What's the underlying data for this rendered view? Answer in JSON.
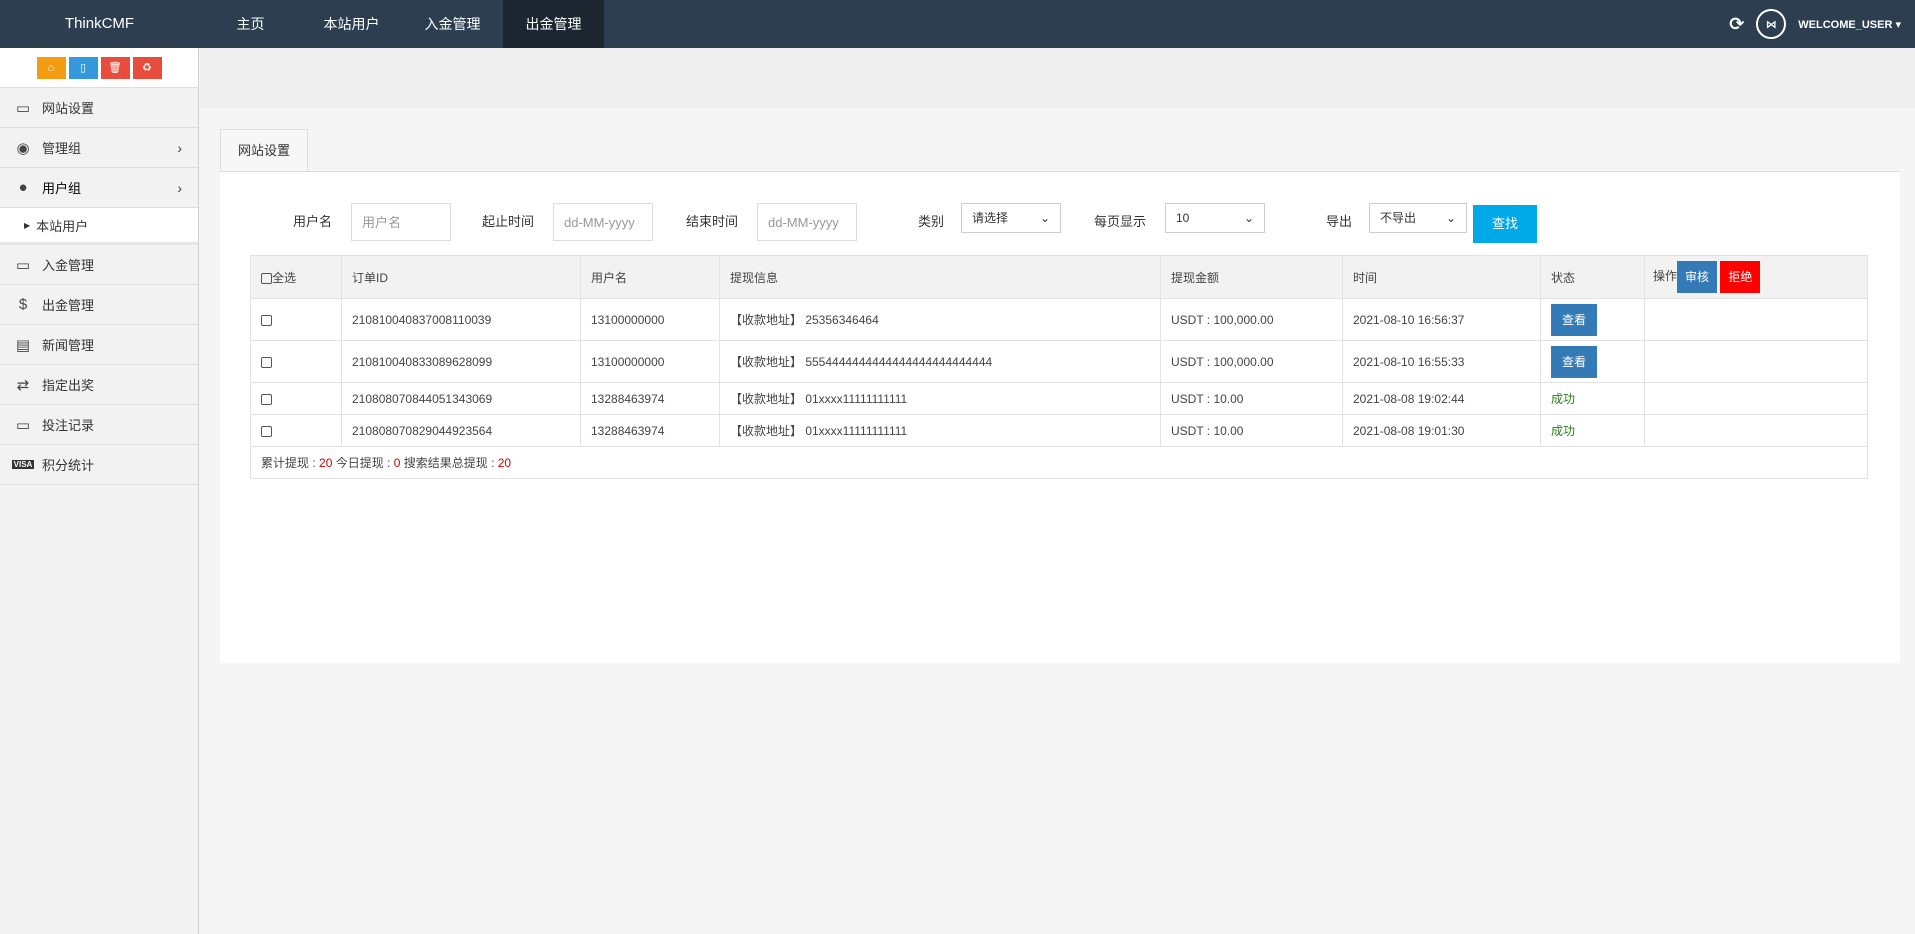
{
  "brand": "ThinkCMF",
  "nav": [
    "主页",
    "本站用户",
    "入金管理",
    "出金管理"
  ],
  "user": "WELCOME_USER",
  "sidebar": {
    "items": [
      "网站设置",
      "管理组",
      "用户组",
      "本站用户",
      "入金管理",
      "出金管理",
      "新闻管理",
      "指定出奖",
      "投注记录",
      "积分统计"
    ]
  },
  "tab": "网站设置",
  "filters": {
    "username_label": "用户名",
    "username_placeholder": "用户名",
    "start_label": "起止时间",
    "start_placeholder": "dd-MM-yyyy",
    "end_label": "结束时间",
    "end_placeholder": "dd-MM-yyyy",
    "type_label": "类别",
    "type_value": "请选择",
    "perpage_label": "每页显示",
    "perpage_value": "10",
    "export_label": "导出",
    "export_value": "不导出",
    "search": "查找"
  },
  "table": {
    "headers": [
      "全选",
      "订单ID",
      "用户名",
      "提现信息",
      "提现金额",
      "时间",
      "状态",
      "操作"
    ],
    "approve": "审核",
    "reject": "拒绝",
    "rows": [
      {
        "id": "210810040837008110039",
        "user": "13100000000",
        "info": "【收款地址】 25356346464",
        "amount": "USDT : 100,000.00",
        "time": "2021-08-10 16:56:37",
        "status": "查看"
      },
      {
        "id": "210810040833089628099",
        "user": "13100000000",
        "info": "【收款地址】 5554444444444444444444444444",
        "amount": "USDT : 100,000.00",
        "time": "2021-08-10 16:55:33",
        "status": "查看"
      },
      {
        "id": "210808070844051343069",
        "user": "13288463974",
        "info": "【收款地址】 01xxxx11111111111",
        "amount": "USDT : 10.00",
        "time": "2021-08-08 19:02:44",
        "status": "成功"
      },
      {
        "id": "210808070829044923564",
        "user": "13288463974",
        "info": "【收款地址】 01xxxx11111111111",
        "amount": "USDT : 10.00",
        "time": "2021-08-08 19:01:30",
        "status": "成功"
      }
    ],
    "footer": {
      "total_label": "累计提现 : ",
      "total": "20",
      "today_label": " 今日提现 : ",
      "today": "0",
      "search_label": " 搜索结果总提现 : ",
      "search_total": "20"
    }
  }
}
